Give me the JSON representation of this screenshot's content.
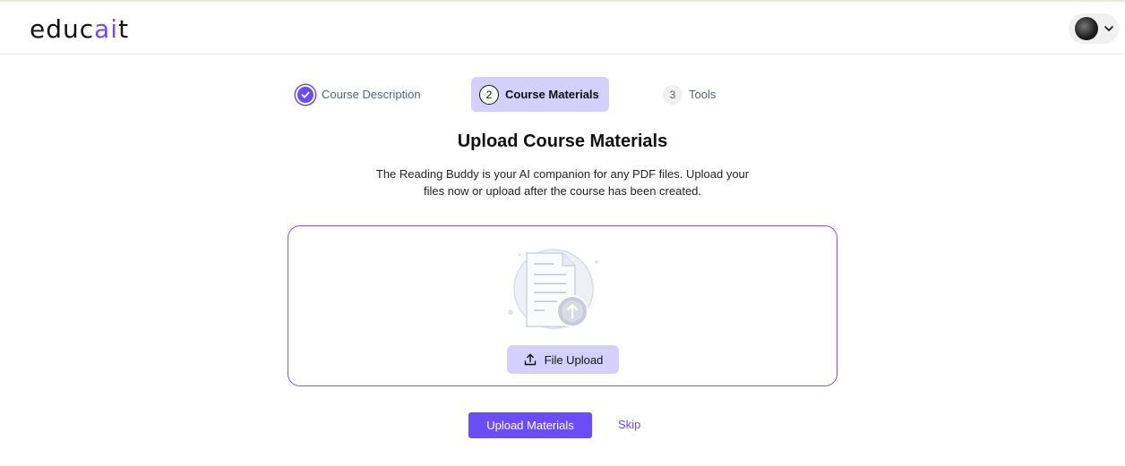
{
  "header": {
    "logo_prefix": "educ",
    "logo_accent": "ai",
    "logo_suffix": "t"
  },
  "steps": [
    {
      "number": "1",
      "label": "Course Description",
      "status": "completed"
    },
    {
      "number": "2",
      "label": "Course Materials",
      "status": "active"
    },
    {
      "number": "3",
      "label": "Tools",
      "status": "pending"
    }
  ],
  "main": {
    "title": "Upload Course Materials",
    "description_line1": "The Reading Buddy is your AI companion for any PDF files. Upload your",
    "description_line2": "files now or upload after the course has been created.",
    "file_upload_label": "File Upload",
    "upload_button_label": "Upload Materials",
    "skip_label": "Skip"
  },
  "colors": {
    "accent": "#6a4df5",
    "accent_light": "#d5d0fb"
  }
}
